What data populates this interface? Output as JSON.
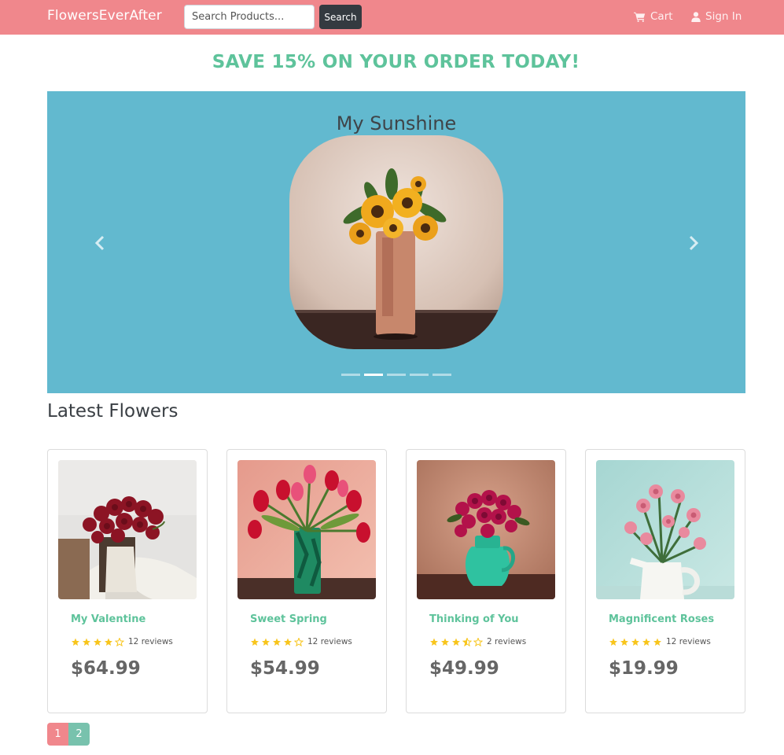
{
  "navbar": {
    "brand": "FlowersEverAfter",
    "search_placeholder": "Search Products...",
    "search_button": "Search",
    "cart_label": "Cart",
    "signin_label": "Sign In"
  },
  "promo": {
    "text": "SAVE 15% ON YOUR ORDER TODAY!"
  },
  "carousel": {
    "title": "My Sunshine",
    "slide_count": 5,
    "active_index": 1
  },
  "section": {
    "title": "Latest Flowers"
  },
  "products": [
    {
      "name": "My Valentine",
      "rating": 4,
      "reviews": "12 reviews",
      "price": "$64.99"
    },
    {
      "name": "Sweet Spring",
      "rating": 4,
      "reviews": "12 reviews",
      "price": "$54.99"
    },
    {
      "name": "Thinking of You",
      "rating": 3.5,
      "reviews": "2 reviews",
      "price": "$49.99"
    },
    {
      "name": "Magnificent Roses",
      "rating": 5,
      "reviews": "12 reviews",
      "price": "$19.99"
    }
  ],
  "pagination": {
    "pages": [
      "1",
      "2"
    ],
    "active": "1"
  },
  "colors": {
    "navbar": "#f0878c",
    "accent_green": "#5ec39b",
    "carousel_bg": "#62b9cf",
    "star": "#f8c51c",
    "page2": "#78c2ad"
  },
  "icons": {
    "cart": "shopping-cart-icon",
    "user": "user-icon",
    "prev": "chevron-left-icon",
    "next": "chevron-right-icon",
    "star": "star-icon"
  }
}
